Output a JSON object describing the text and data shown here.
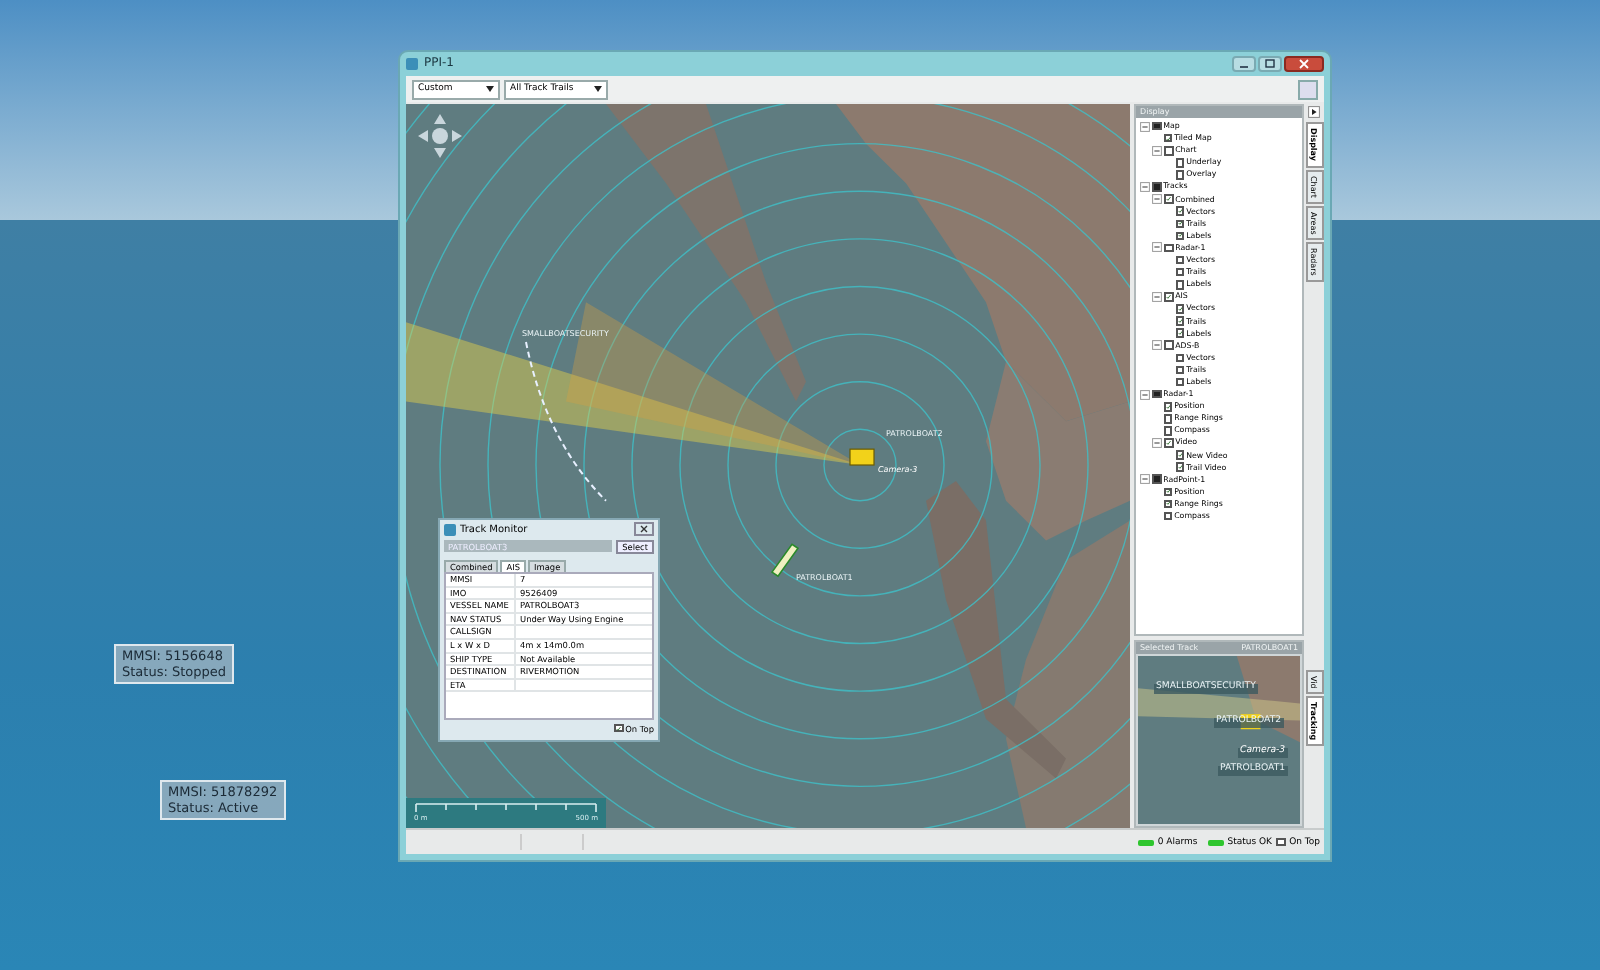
{
  "desktop": {
    "callouts": [
      {
        "lines": [
          "MMSI: 5156648",
          "Status: Stopped"
        ]
      },
      {
        "lines": [
          "MMSI: 51878292",
          "Status: Active"
        ]
      }
    ]
  },
  "window": {
    "title": "PPI-1"
  },
  "toolbar": {
    "dropdowns": [
      "Custom",
      "All Track Trails"
    ]
  },
  "map": {
    "labels": [
      {
        "kind": "track",
        "text": "SMALLBOATSECURITY"
      },
      {
        "kind": "track",
        "text": "PATROLBOAT2"
      },
      {
        "kind": "camera",
        "text": "Camera-3"
      },
      {
        "kind": "track",
        "text": "PATROLBOAT1"
      }
    ],
    "scale": {
      "start": "0 m",
      "end": "500 m"
    }
  },
  "track_monitor": {
    "title": "Track Monitor",
    "track": "PATROLBOAT3",
    "select_button": "Select",
    "tabs": [
      {
        "label": "Combined",
        "selected": false
      },
      {
        "label": "AIS",
        "selected": true
      },
      {
        "label": "Image",
        "selected": false
      }
    ],
    "rows": [
      {
        "field": "MMSI",
        "value": "7"
      },
      {
        "field": "IMO",
        "value": "9526409"
      },
      {
        "field": "VESSEL NAME",
        "value": "PATROLBOAT3"
      },
      {
        "field": "NAV STATUS",
        "value": "Under Way Using Engine"
      },
      {
        "field": "CALLSIGN"
      },
      {
        "field": "L x W x D",
        "value": "4m x 14m0.0m"
      },
      {
        "field": "SHIP TYPE",
        "value": "Not Available"
      },
      {
        "field": "DESTINATION",
        "value": "RIVERMOTION"
      },
      {
        "field": "ETA"
      }
    ],
    "on_top": {
      "label": "On Top",
      "checked": true
    }
  },
  "display_panel": {
    "title": "Display",
    "tree": [
      {
        "label": "Map",
        "checked": true,
        "mixed": true,
        "expanded": true,
        "children": [
          {
            "label": "Tiled Map",
            "checked": true,
            "mixed": false
          },
          {
            "label": "Chart",
            "checked": false,
            "mixed": false,
            "expanded": true,
            "children": [
              {
                "label": "Underlay",
                "checked": false,
                "mixed": false
              },
              {
                "label": "Overlay",
                "checked": false,
                "mixed": false
              }
            ]
          }
        ]
      },
      {
        "label": "Tracks",
        "checked": true,
        "mixed": true,
        "expanded": true,
        "children": [
          {
            "label": "Combined",
            "checked": true,
            "mixed": false,
            "expanded": true,
            "children": [
              {
                "label": "Vectors",
                "checked": true,
                "mixed": false
              },
              {
                "label": "Trails",
                "checked": true,
                "mixed": false
              },
              {
                "label": "Labels",
                "checked": true,
                "mixed": false
              }
            ]
          },
          {
            "label": "Radar-1",
            "checked": false,
            "mixed": false,
            "expanded": true,
            "children": [
              {
                "label": "Vectors",
                "checked": false,
                "mixed": false
              },
              {
                "label": "Trails",
                "checked": false,
                "mixed": false
              },
              {
                "label": "Labels",
                "checked": false,
                "mixed": false
              }
            ]
          },
          {
            "label": "AIS",
            "checked": true,
            "mixed": false,
            "expanded": true,
            "children": [
              {
                "label": "Vectors",
                "checked": true,
                "mixed": false
              },
              {
                "label": "Trails",
                "checked": true,
                "mixed": false
              },
              {
                "label": "Labels",
                "checked": true,
                "mixed": false
              }
            ]
          },
          {
            "label": "ADS-B",
            "checked": false,
            "mixed": false,
            "expanded": true,
            "children": [
              {
                "label": "Vectors",
                "checked": false,
                "mixed": false
              },
              {
                "label": "Trails",
                "checked": false,
                "mixed": false
              },
              {
                "label": "Labels",
                "checked": false,
                "mixed": false
              }
            ]
          }
        ]
      },
      {
        "label": "Radar-1",
        "checked": true,
        "mixed": true,
        "expanded": true,
        "children": [
          {
            "label": "Position",
            "checked": true,
            "mixed": false
          },
          {
            "label": "Range Rings",
            "checked": false,
            "mixed": false
          },
          {
            "label": "Compass",
            "checked": false,
            "mixed": false
          },
          {
            "label": "Video",
            "checked": true,
            "mixed": false,
            "expanded": true,
            "children": [
              {
                "label": "New Video",
                "checked": true,
                "mixed": false
              },
              {
                "label": "Trail Video",
                "checked": true,
                "mixed": false
              }
            ]
          }
        ]
      },
      {
        "label": "RadPoint-1",
        "checked": true,
        "mixed": true,
        "expanded": true,
        "children": [
          {
            "label": "Position",
            "checked": true,
            "mixed": false
          },
          {
            "label": "Range Rings",
            "checked": true,
            "mixed": false
          },
          {
            "label": "Compass",
            "checked": false,
            "mixed": false
          }
        ]
      }
    ],
    "side_tabs": [
      {
        "label": "Display",
        "selected": true
      },
      {
        "label": "Chart",
        "selected": false
      },
      {
        "label": "Areas",
        "selected": false
      },
      {
        "label": "Radars",
        "selected": false
      }
    ]
  },
  "selected_track": {
    "title": "Selected Track",
    "track": "PATROLBOAT1",
    "labels": [
      {
        "kind": "track",
        "text": "SMALLBOATSECURITY"
      },
      {
        "kind": "track",
        "text": "PATROLBOAT2"
      },
      {
        "kind": "camera",
        "text": "Camera-3"
      },
      {
        "kind": "track",
        "text": "PATROLBOAT1"
      }
    ],
    "side_tabs": [
      {
        "label": "Vid",
        "selected": false
      },
      {
        "label": "Tracking",
        "selected": true
      }
    ]
  },
  "status_bar": {
    "alarms": "0 Alarms",
    "status": "Status OK",
    "on_top": {
      "label": "On Top",
      "checked": false
    }
  }
}
